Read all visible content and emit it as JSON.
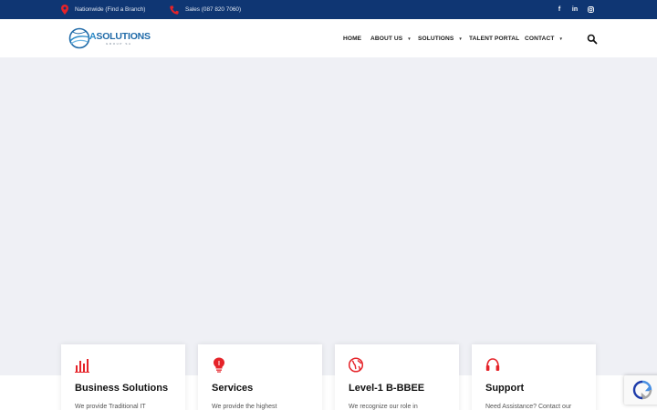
{
  "topbar": {
    "location": "Nationwide (Find a Branch)",
    "phone": "Sales (087 820 7060)",
    "social": [
      {
        "icon": "facebook-icon",
        "glyph": "f"
      },
      {
        "icon": "linkedin-icon",
        "glyph": "in"
      },
      {
        "icon": "instagram-icon",
        "glyph": ""
      }
    ]
  },
  "header": {
    "logo": {
      "text_a": "A",
      "text_rest": "SOLUTIONS",
      "tagline": "GROUP SA"
    },
    "nav": [
      {
        "label": "HOME",
        "dropdown": false
      },
      {
        "label": "ABOUT US",
        "dropdown": true
      },
      {
        "label": "SOLUTIONS",
        "dropdown": true
      },
      {
        "label": "TALENT PORTAL",
        "dropdown": false
      },
      {
        "label": "CONTACT",
        "dropdown": true
      }
    ],
    "caret": "▼"
  },
  "cards": [
    {
      "icon": "bar-chart-icon",
      "title": "Business Solutions",
      "text": "We provide Traditional IT"
    },
    {
      "icon": "lightbulb-icon",
      "title": "Services",
      "text": "We provide the highest"
    },
    {
      "icon": "globe-icon",
      "title": "Level-1 B-BBEE",
      "text": "We recognize our role in"
    },
    {
      "icon": "headset-icon",
      "title": "Support",
      "text": "Need Assistance? Contact our"
    }
  ],
  "colors": {
    "topbar": "#0f3673",
    "accent": "#e52329",
    "hero": "#eff0f5",
    "logo_blue": "#1f6aa8"
  }
}
